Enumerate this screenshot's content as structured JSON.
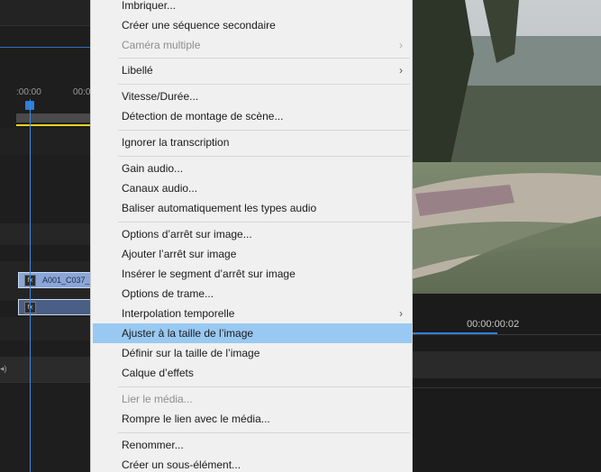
{
  "timeline": {
    "timecode_left": ":00:00",
    "timecode_right": "00:0",
    "clip_name": "A001_C037_"
  },
  "monitor": {
    "timecode": "00:00:00:02"
  },
  "menu": {
    "items": [
      {
        "label": "Imbriquer...",
        "enabled": true
      },
      {
        "label": "Créer une séquence secondaire",
        "enabled": true
      },
      {
        "label": "Caméra multiple",
        "enabled": false,
        "submenu": true
      },
      {
        "label": "Libellé",
        "enabled": true,
        "submenu": true
      },
      {
        "label": "Vitesse/Durée...",
        "enabled": true
      },
      {
        "label": "Détection de montage de scène...",
        "enabled": true
      },
      {
        "label": "Ignorer la transcription",
        "enabled": true
      },
      {
        "label": "Gain audio...",
        "enabled": true
      },
      {
        "label": "Canaux audio...",
        "enabled": true
      },
      {
        "label": "Baliser automatiquement les types audio",
        "enabled": true
      },
      {
        "label": "Options d’arrêt sur image...",
        "enabled": true
      },
      {
        "label": "Ajouter l’arrêt sur image",
        "enabled": true
      },
      {
        "label": "Insérer le segment d’arrêt sur image",
        "enabled": true
      },
      {
        "label": "Options de trame...",
        "enabled": true
      },
      {
        "label": "Interpolation temporelle",
        "enabled": true,
        "submenu": true
      },
      {
        "label": "Ajuster à la taille de l’image",
        "enabled": true,
        "highlighted": true
      },
      {
        "label": "Définir sur la taille de l’image",
        "enabled": true
      },
      {
        "label": "Calque d’effets",
        "enabled": true
      },
      {
        "label": "Lier le média...",
        "enabled": false
      },
      {
        "label": "Rompre le lien avec le média...",
        "enabled": true
      },
      {
        "label": "Renommer...",
        "enabled": true
      },
      {
        "label": "Créer un sous-élément...",
        "enabled": true
      }
    ],
    "submenu_glyph": "›",
    "highlight_color": "#99c9f2"
  },
  "colors": {
    "accent_blue": "#2f7fd8",
    "work_area_yellow": "#e6d21e"
  }
}
